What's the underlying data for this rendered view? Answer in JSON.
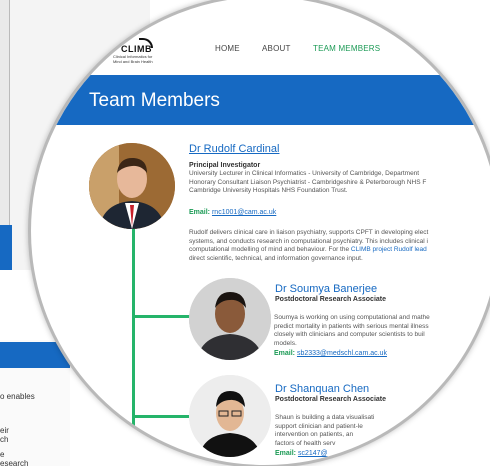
{
  "background": {
    "snippets": [
      "o enables",
      "eir",
      "ch",
      "e",
      "esearch"
    ]
  },
  "logo": {
    "title": "CLIMB",
    "subtitle_line1": "Clinical Informatics for",
    "subtitle_line2": "Mind and Brain Health"
  },
  "nav": {
    "items": [
      "HOME",
      "ABOUT",
      "TEAM MEMBERS"
    ],
    "active": "TEAM MEMBERS"
  },
  "page": {
    "title": "Team Members"
  },
  "colors": {
    "brand_blue": "#1669c2",
    "accent_green": "#25b46a"
  },
  "members": [
    {
      "name": "Dr Rudolf Cardinal",
      "role": "Principal Investigator",
      "details": [
        "University Lecturer in Clinical Informatics - University of Cambridge, Department",
        "Honorary Consultant Liaison Psychiatrist - Cambridgeshire & Peterborough NHS F",
        "Cambridge University Hospitals NHS Foundation Trust."
      ],
      "email_label": "Email:",
      "email": "rnc1001@cam.ac.uk",
      "bio": [
        "Rudolf delivers clinical care in liaison psychiatry, supports CPFT in developing elect",
        "systems, and conducts research in computational psychiatry. This includes clinical i",
        "computational modelling of mind and behaviour. For the ",
        "direct scientific, technical, and information governance  input."
      ],
      "bio_link": "CLIMB project Rudolf lead"
    },
    {
      "name": "Dr Soumya Banerjee",
      "role": "Postdoctoral Research Associate",
      "bio": [
        "Soumya is working on using computational and mathe",
        "predict mortality in patients with serious mental illness",
        "closely with clinicians and computer scientists to buil",
        "models."
      ],
      "email_label": "Email:",
      "email": "sb2333@medschl.cam.ac.uk"
    },
    {
      "name": "Dr Shanquan Chen",
      "role": "Postdoctoral Research Associate",
      "bio": [
        "Shaun is building a data visualisati",
        "support clinician and patient-le",
        "intervention on patients, an",
        "factors of health serv"
      ],
      "email_label": "Email:",
      "email": "sc2147@"
    }
  ]
}
